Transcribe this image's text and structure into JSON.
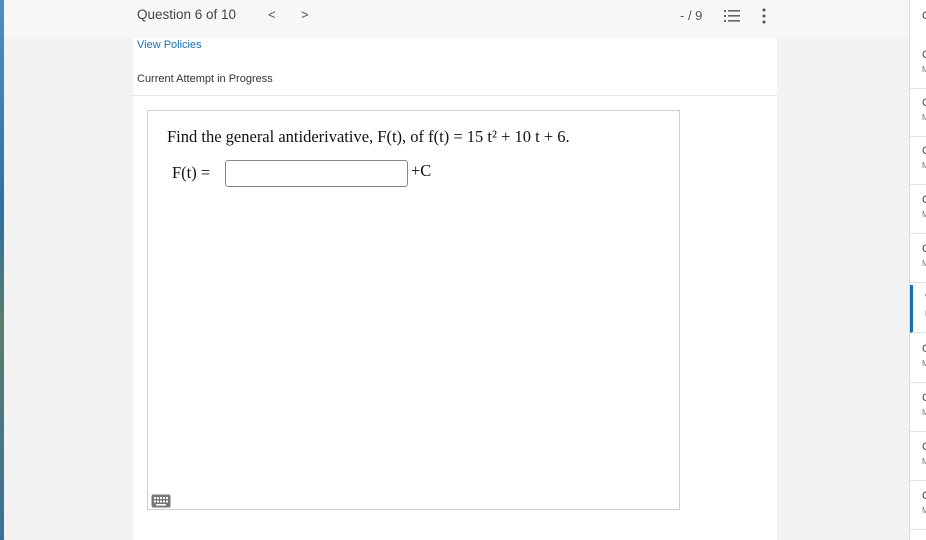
{
  "header": {
    "question_counter": "Question 6 of 10",
    "prev_label": "<",
    "next_label": ">",
    "score": "- / 9"
  },
  "panel": {
    "view_policies": "View Policies",
    "attempt_status": "Current Attempt in Progress"
  },
  "question": {
    "prompt_text": "Find the general antiderivative, F(t), of f(t) = 15 t² + 10 t + 6.",
    "answer_label": "F(t) =",
    "answer_value": "",
    "constant": "+C"
  },
  "sidebar": {
    "items": [
      {
        "letter": "C",
        "sub": "M"
      },
      {
        "letter": "C",
        "sub": "M"
      },
      {
        "letter": "C",
        "sub": "M"
      },
      {
        "letter": "C",
        "sub": "M"
      },
      {
        "letter": "C",
        "sub": "M"
      },
      {
        "letter": "V",
        "sub": "M"
      },
      {
        "letter": "C",
        "sub": "M"
      },
      {
        "letter": "C",
        "sub": "M"
      },
      {
        "letter": "C",
        "sub": "M"
      },
      {
        "letter": "C",
        "sub": "M"
      }
    ],
    "top_letter": "C"
  },
  "colors": {
    "link": "#1a6fb0",
    "accent": "#1a6fb0"
  },
  "icons": {
    "list": "list-icon",
    "more": "more-vertical-icon",
    "keyboard": "keyboard-icon"
  }
}
